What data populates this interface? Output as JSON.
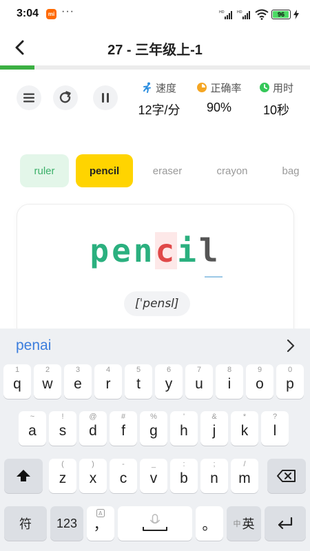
{
  "status_bar": {
    "time": "3:04",
    "mi_badge": "mi",
    "more": "···",
    "battery": "96",
    "battery_level": 0.96,
    "colors": {
      "accent": "#ff6900",
      "battery": "#4cd964"
    }
  },
  "header": {
    "back_icon": "chevron-left-icon",
    "title": "27 - 三年级上-1"
  },
  "progress": {
    "value": 0.11,
    "color": "#3cb043"
  },
  "controls": {
    "menu_icon": "menu-icon",
    "restart_icon": "refresh-icon",
    "pause_icon": "pause-icon"
  },
  "stats": {
    "speed": {
      "label": "速度",
      "value": "12字/分",
      "icon": "runner-icon"
    },
    "accuracy": {
      "label": "正确率",
      "value": "90%",
      "icon": "pie-icon"
    },
    "time": {
      "label": "用时",
      "value": "10秒",
      "icon": "clock-icon"
    }
  },
  "words": [
    {
      "text": "ruler",
      "state": "done"
    },
    {
      "text": "pencil",
      "state": "current"
    },
    {
      "text": "eraser",
      "state": "upcoming"
    },
    {
      "text": "crayon",
      "state": "upcoming"
    },
    {
      "text": "bag",
      "state": "upcoming"
    }
  ],
  "card": {
    "typed_correct": "pen",
    "current_letter": "c",
    "typed_after": "i",
    "remaining": "l",
    "phonetic": "[ˈpensl]"
  },
  "keyboard": {
    "candidate": "penai",
    "candidate_arrow_icon": "chevron-right-icon",
    "row1": [
      {
        "k": "q",
        "h": "1"
      },
      {
        "k": "w",
        "h": "2"
      },
      {
        "k": "e",
        "h": "3"
      },
      {
        "k": "r",
        "h": "4"
      },
      {
        "k": "t",
        "h": "5"
      },
      {
        "k": "y",
        "h": "6"
      },
      {
        "k": "u",
        "h": "7"
      },
      {
        "k": "i",
        "h": "8"
      },
      {
        "k": "o",
        "h": "9"
      },
      {
        "k": "p",
        "h": "0"
      }
    ],
    "row2": [
      {
        "k": "a",
        "h": "~"
      },
      {
        "k": "s",
        "h": "!"
      },
      {
        "k": "d",
        "h": "@"
      },
      {
        "k": "f",
        "h": "#"
      },
      {
        "k": "g",
        "h": "%"
      },
      {
        "k": "h",
        "h": "'"
      },
      {
        "k": "j",
        "h": "&"
      },
      {
        "k": "k",
        "h": "*"
      },
      {
        "k": "l",
        "h": "?"
      }
    ],
    "row3": [
      {
        "k": "z",
        "h": "("
      },
      {
        "k": "x",
        "h": ")"
      },
      {
        "k": "c",
        "h": "-"
      },
      {
        "k": "v",
        "h": "_"
      },
      {
        "k": "b",
        "h": ":"
      },
      {
        "k": "n",
        "h": ";"
      },
      {
        "k": "m",
        "h": "/"
      }
    ],
    "shift_icon": "shift-icon",
    "backspace_icon": "backspace-icon",
    "symbols_label": "符",
    "numbers_label": "123",
    "comma_label": "，",
    "comma_hint_icon": "a-icon",
    "space_icon": "microphone-icon",
    "period_label": "。",
    "lang_small": "中",
    "lang_label": "英",
    "enter_icon": "enter-icon"
  }
}
